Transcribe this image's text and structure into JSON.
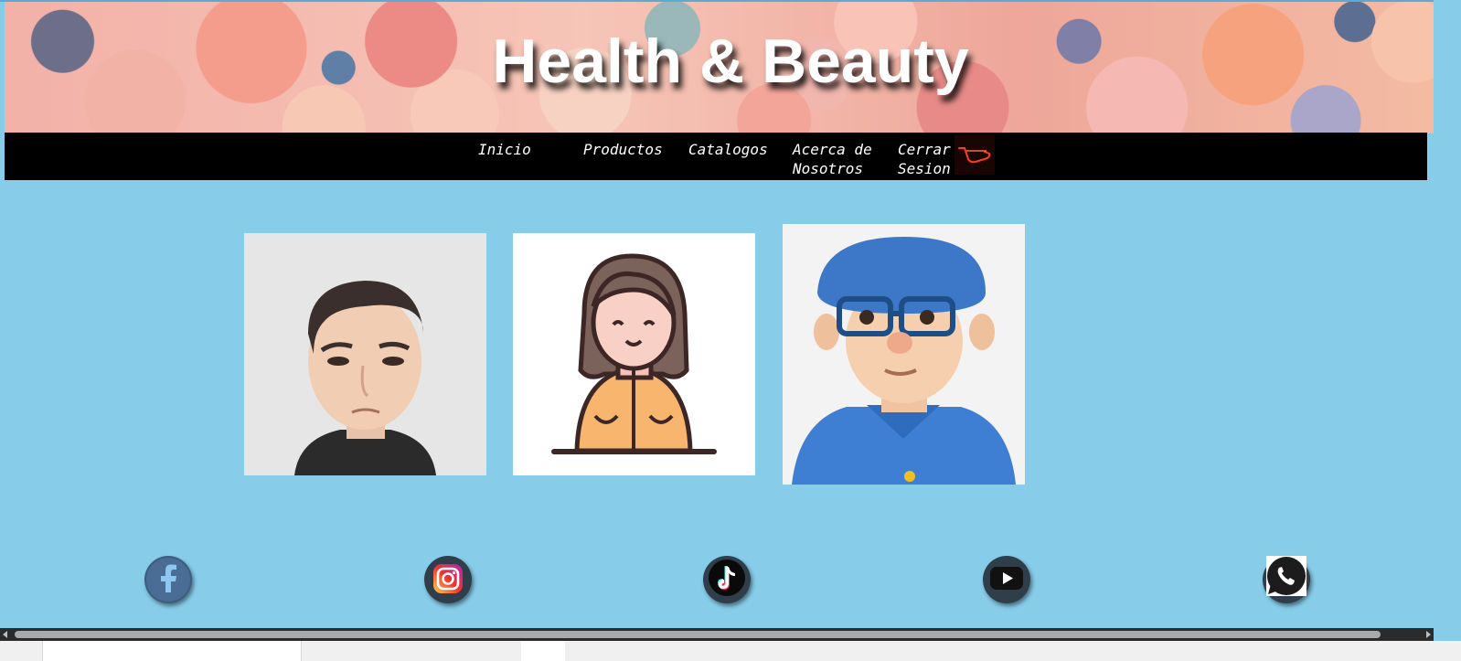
{
  "header": {
    "title": "Health & Beauty"
  },
  "nav": {
    "items": [
      {
        "label": "Inicio"
      },
      {
        "label": "Productos"
      },
      {
        "label": "Catalogos"
      },
      {
        "label": "Acerca de Nosotros"
      },
      {
        "label": "Cerrar Sesion"
      }
    ],
    "cart_icon": "shopping-cart-icon"
  },
  "team": {
    "avatars": [
      {
        "icon": "avatar-man-3d"
      },
      {
        "icon": "avatar-woman-illustration"
      },
      {
        "icon": "avatar-man-blue-hat-3d"
      }
    ]
  },
  "footer": {
    "social": [
      {
        "icon": "facebook-icon"
      },
      {
        "icon": "instagram-icon"
      },
      {
        "icon": "tiktok-icon"
      },
      {
        "icon": "youtube-icon"
      },
      {
        "icon": "whatsapp-icon"
      }
    ]
  },
  "colors": {
    "page_background": "#87cce9",
    "navbar_background": "#000000",
    "nav_text": "#ffffff",
    "cart_accent": "#ff3b1f"
  }
}
